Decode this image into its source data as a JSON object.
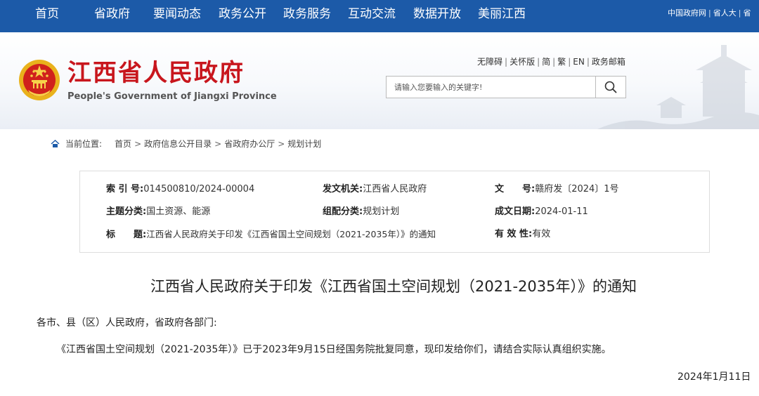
{
  "topnav": {
    "items": [
      "首页",
      "省政府",
      "要闻动态",
      "政务公开",
      "政务服务",
      "互动交流",
      "数据开放",
      "美丽江西"
    ],
    "links": [
      "中国政府网",
      "省人大",
      "省"
    ]
  },
  "header": {
    "site_name_cn": "江西省人民政府",
    "site_name_en": "People's Government of Jiangxi Province",
    "utility_links": [
      "无障碍",
      "关怀版",
      "简",
      "繁",
      "EN",
      "政务邮箱"
    ],
    "search_placeholder": "请输入您要输入的关键字!"
  },
  "breadcrumb": {
    "label": "当前位置:",
    "items": [
      "首页",
      "政府信息公开目录",
      "省政府办公厅",
      "规划计划"
    ]
  },
  "info": {
    "index_label": "索 引 号:",
    "index_value": "014500810/2024-00004",
    "issuer_label": "发文机关:",
    "issuer_value": "江西省人民政府",
    "docno_label": "文　　号:",
    "docno_value": "赣府发〔2024〕1号",
    "topic_label": "主题分类:",
    "topic_value": "国土资源、能源",
    "category_label": "组配分类:",
    "category_value": "规划计划",
    "date_label": "成文日期:",
    "date_value": "2024-01-11",
    "title_label": "标　　题:",
    "title_value": "江西省人民政府关于印发《江西省国土空间规划（2021-2035年）》的通知",
    "validity_label": "有 效 性:",
    "validity_value": "有效"
  },
  "article": {
    "title": "江西省人民政府关于印发《江西省国土空间规划（2021-2035年）》的通知",
    "salutation": "各市、县（区）人民政府，省政府各部门:",
    "body": "《江西省国土空间规划（2021-2035年）》已于2023年9月15日经国务院批复同意，现印发给你们，请结合实际认真组织实施。",
    "date": "2024年1月11日"
  },
  "colors": {
    "nav_bg": "#1c5aa8",
    "brand_red": "#c8161d",
    "emblem_gold": "#e9b21c"
  },
  "icons": [
    "national-emblem-icon",
    "search-icon",
    "home-icon"
  ]
}
